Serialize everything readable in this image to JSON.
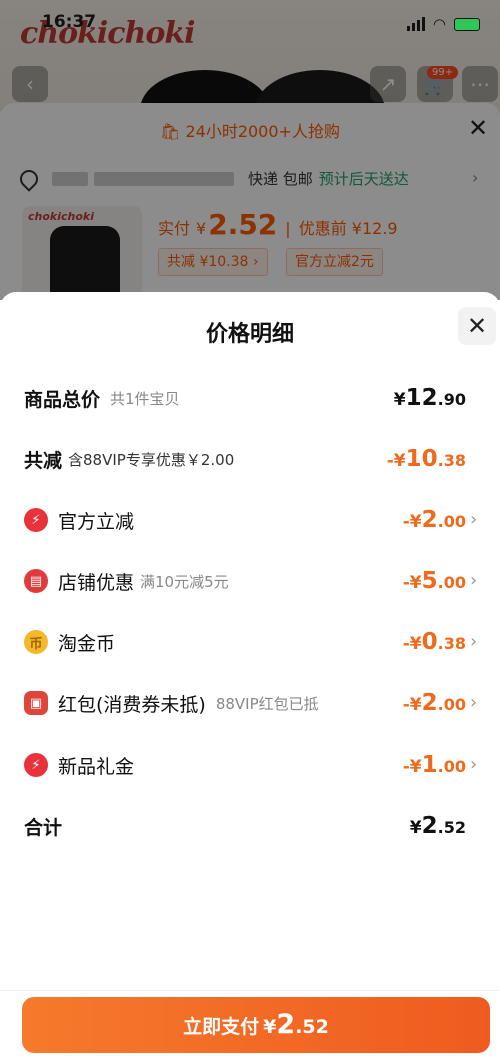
{
  "status_bar": {
    "time": "16:37"
  },
  "background_page": {
    "brand": "chokichoki",
    "cart_badge": "99+",
    "rush_text": "24小时2000+人抢购",
    "shipping": "快递 包邮",
    "eta": "预计后天送达",
    "price_label": "实付",
    "price_yen": "¥",
    "price_value": "2.52",
    "price_before": "优惠前 ¥12.9",
    "chip_reduce": "共减 ¥10.38 ›",
    "chip_official": "官方立减2元"
  },
  "detail": {
    "title": "价格明细",
    "rows": [
      {
        "name": "商品总价",
        "sub": "共1件宝贝",
        "pre": "¥",
        "int": "12",
        "dec": ".90",
        "color": "black",
        "arrow": false,
        "icon": null
      },
      {
        "name": "共减",
        "sub": "含88VIP专享优惠￥2.00",
        "pre": "-¥",
        "int": "10",
        "dec": ".38",
        "color": "orange",
        "arrow": false,
        "icon": null
      },
      {
        "name": "官方立减",
        "sub": "",
        "pre": "-¥",
        "int": "2",
        "dec": ".00",
        "color": "orange",
        "arrow": true,
        "icon": "lightning-icon"
      },
      {
        "name": "店铺优惠",
        "sub": "满10元减5元",
        "pre": "-¥",
        "int": "5",
        "dec": ".00",
        "color": "orange",
        "arrow": true,
        "icon": "store-icon"
      },
      {
        "name": "淘金币",
        "sub": "",
        "pre": "-¥",
        "int": "0",
        "dec": ".38",
        "color": "orange",
        "arrow": true,
        "icon": "coin-icon"
      },
      {
        "name": "红包(消费券未抵)",
        "sub": "88VIP红包已抵",
        "pre": "-¥",
        "int": "2",
        "dec": ".00",
        "color": "orange",
        "arrow": true,
        "icon": "red-packet-icon"
      },
      {
        "name": "新品礼金",
        "sub": "",
        "pre": "-¥",
        "int": "1",
        "dec": ".00",
        "color": "orange",
        "arrow": true,
        "icon": "lightning-icon"
      },
      {
        "name": "合计",
        "sub": "",
        "pre": "¥",
        "int": "2",
        "dec": ".52",
        "color": "black",
        "arrow": false,
        "icon": null
      }
    ],
    "pay_button": {
      "label": "立即支付",
      "yen": "¥",
      "int": "2",
      "dec": ".52"
    }
  },
  "colors": {
    "accent": "#f06a1c",
    "button": "#f06a25",
    "eta_green": "#22a06b"
  }
}
